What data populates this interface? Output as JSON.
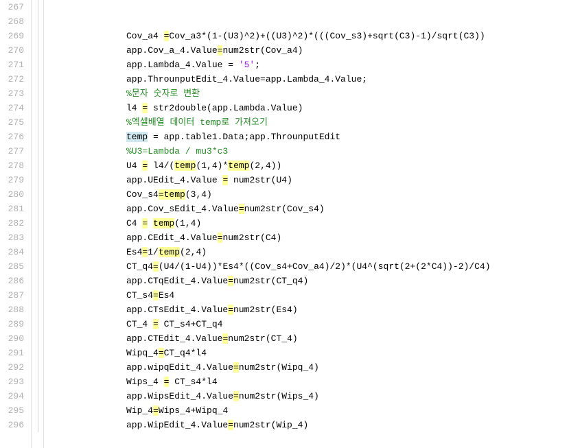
{
  "lines": [
    {
      "num": 267,
      "tokens": []
    },
    {
      "num": 268,
      "tokens": []
    },
    {
      "num": 269,
      "tokens": [
        {
          "t": "Cov_a4 "
        },
        {
          "t": "=",
          "cls": "hl"
        },
        {
          "t": "Cov_a3*(1-(U3)^2)+((U3)^2)*(((Cov_s3)+sqrt(C3)-1)/sqrt(C3))"
        }
      ]
    },
    {
      "num": 270,
      "tokens": [
        {
          "t": "app.Cov_a_4.Value"
        },
        {
          "t": "=",
          "cls": "hl"
        },
        {
          "t": "num2str(Cov_a4)"
        }
      ]
    },
    {
      "num": 271,
      "tokens": [
        {
          "t": "app.Lambda_4.Value = "
        },
        {
          "t": "'5'",
          "cls": "string"
        },
        {
          "t": ";"
        }
      ]
    },
    {
      "num": 272,
      "tokens": [
        {
          "t": "app.ThrounputEdit_4.Value=app.Lambda_4.Value;"
        }
      ]
    },
    {
      "num": 273,
      "tokens": [
        {
          "t": "%문자 숫자로 변환",
          "cls": "comment"
        }
      ]
    },
    {
      "num": 274,
      "tokens": [
        {
          "t": "l4 "
        },
        {
          "t": "=",
          "cls": "hl"
        },
        {
          "t": " str2double(app.Lambda.Value)"
        }
      ]
    },
    {
      "num": 275,
      "tokens": [
        {
          "t": "%엑셀배열 데이터 temp로 가져오기",
          "cls": "comment"
        }
      ]
    },
    {
      "num": 276,
      "tokens": [
        {
          "t": "temp",
          "cls": "cursor-hl"
        },
        {
          "t": " = app.table1.Data;app.ThrounputEdit"
        }
      ]
    },
    {
      "num": 277,
      "tokens": [
        {
          "t": "%U3=Lambda / mu3*c3",
          "cls": "comment"
        }
      ]
    },
    {
      "num": 278,
      "tokens": [
        {
          "t": "U4 "
        },
        {
          "t": "=",
          "cls": "hl"
        },
        {
          "t": " l4/("
        },
        {
          "t": "temp",
          "cls": "hl"
        },
        {
          "t": "(1,4)*"
        },
        {
          "t": "temp",
          "cls": "hl"
        },
        {
          "t": "(2,4))"
        }
      ]
    },
    {
      "num": 279,
      "tokens": [
        {
          "t": "app.UEdit_4.Value "
        },
        {
          "t": "=",
          "cls": "hl"
        },
        {
          "t": " num2str(U4)"
        }
      ]
    },
    {
      "num": 280,
      "tokens": [
        {
          "t": "Cov_s4"
        },
        {
          "t": "=",
          "cls": "hl"
        },
        {
          "t": "temp",
          "cls": "hl"
        },
        {
          "t": "(3,4)"
        }
      ]
    },
    {
      "num": 281,
      "tokens": [
        {
          "t": "app.Cov_sEdit_4.Value"
        },
        {
          "t": "=",
          "cls": "hl"
        },
        {
          "t": "num2str(Cov_s4)"
        }
      ]
    },
    {
      "num": 282,
      "tokens": [
        {
          "t": "C4 "
        },
        {
          "t": "=",
          "cls": "hl"
        },
        {
          "t": " "
        },
        {
          "t": "temp",
          "cls": "hl"
        },
        {
          "t": "(1,4)"
        }
      ]
    },
    {
      "num": 283,
      "tokens": [
        {
          "t": "app.CEdit_4.Value"
        },
        {
          "t": "=",
          "cls": "hl"
        },
        {
          "t": "num2str(C4)"
        }
      ]
    },
    {
      "num": 284,
      "tokens": [
        {
          "t": "Es4"
        },
        {
          "t": "=",
          "cls": "hl"
        },
        {
          "t": "1/"
        },
        {
          "t": "temp",
          "cls": "hl"
        },
        {
          "t": "(2,4)"
        }
      ]
    },
    {
      "num": 285,
      "tokens": [
        {
          "t": "CT_q4"
        },
        {
          "t": "=",
          "cls": "hl"
        },
        {
          "t": "(U4/(1-U4))*Es4*((Cov_s4+Cov_a4)/2)*(U4^(sqrt(2+(2*C4))-2)/C4)"
        }
      ]
    },
    {
      "num": 286,
      "tokens": [
        {
          "t": "app.CTqEdit_4.Value"
        },
        {
          "t": "=",
          "cls": "hl"
        },
        {
          "t": "num2str(CT_q4)"
        }
      ]
    },
    {
      "num": 287,
      "tokens": [
        {
          "t": "CT_s4"
        },
        {
          "t": "=",
          "cls": "hl"
        },
        {
          "t": "Es4"
        }
      ]
    },
    {
      "num": 288,
      "tokens": [
        {
          "t": "app.CTsEdit_4.Value"
        },
        {
          "t": "=",
          "cls": "hl"
        },
        {
          "t": "num2str(Es4)"
        }
      ]
    },
    {
      "num": 289,
      "tokens": [
        {
          "t": "CT_4 "
        },
        {
          "t": "=",
          "cls": "hl"
        },
        {
          "t": " CT_s4+CT_q4"
        }
      ]
    },
    {
      "num": 290,
      "tokens": [
        {
          "t": "app.CTEdit_4.Value"
        },
        {
          "t": "=",
          "cls": "hl"
        },
        {
          "t": "num2str(CT_4)"
        }
      ]
    },
    {
      "num": 291,
      "tokens": [
        {
          "t": "Wipq_4"
        },
        {
          "t": "=",
          "cls": "hl"
        },
        {
          "t": "CT_q4*l4"
        }
      ]
    },
    {
      "num": 292,
      "tokens": [
        {
          "t": "app.wipqEdit_4.Value"
        },
        {
          "t": "=",
          "cls": "hl"
        },
        {
          "t": "num2str(Wipq_4)"
        }
      ]
    },
    {
      "num": 293,
      "tokens": [
        {
          "t": "Wips_4 "
        },
        {
          "t": "=",
          "cls": "hl"
        },
        {
          "t": " CT_s4*l4"
        }
      ]
    },
    {
      "num": 294,
      "tokens": [
        {
          "t": "app.WipsEdit_4.Value"
        },
        {
          "t": "=",
          "cls": "hl"
        },
        {
          "t": "num2str(Wips_4)"
        }
      ]
    },
    {
      "num": 295,
      "tokens": [
        {
          "t": "Wip_4"
        },
        {
          "t": "=",
          "cls": "hl"
        },
        {
          "t": "Wips_4+Wipq_4"
        }
      ]
    },
    {
      "num": 296,
      "tokens": [
        {
          "t": "app.WipEdit_4.Value"
        },
        {
          "t": "=",
          "cls": "hl"
        },
        {
          "t": "num2str(Wip_4)"
        }
      ]
    }
  ]
}
